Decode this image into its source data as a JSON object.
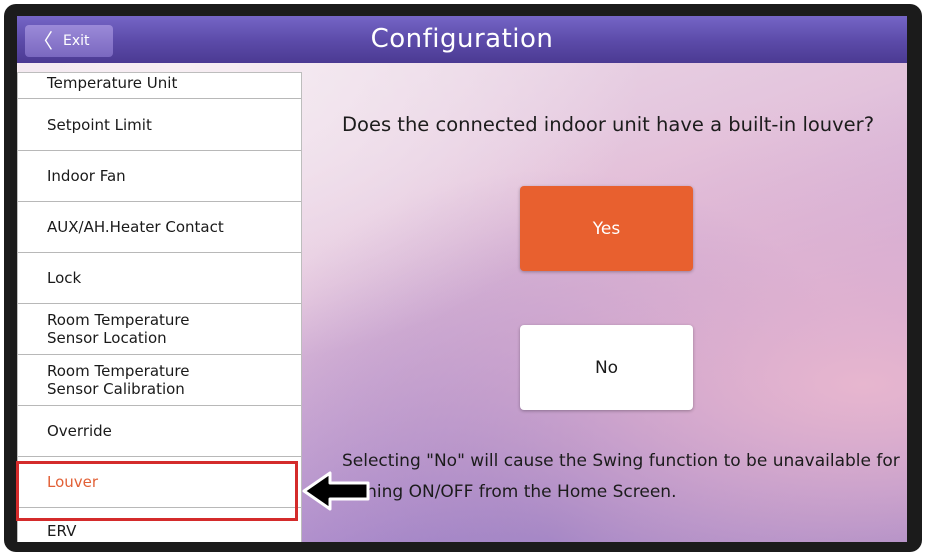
{
  "header": {
    "exit_label": "Exit",
    "title": "Configuration"
  },
  "sidebar": {
    "items": [
      {
        "line1": "Temperature Unit",
        "line2": ""
      },
      {
        "line1": "Setpoint Limit",
        "line2": ""
      },
      {
        "line1": "Indoor Fan",
        "line2": ""
      },
      {
        "line1": "AUX/AH.Heater Contact",
        "line2": ""
      },
      {
        "line1": "Lock",
        "line2": ""
      },
      {
        "line1": "Room Temperature",
        "line2": "Sensor Location"
      },
      {
        "line1": "Room Temperature",
        "line2": "Sensor Calibration"
      },
      {
        "line1": "Override",
        "line2": ""
      },
      {
        "line1": "Louver",
        "line2": ""
      },
      {
        "line1": "ERV",
        "line2": ""
      }
    ],
    "active": "Louver"
  },
  "main": {
    "question": "Does the connected indoor unit have a built-in louver?",
    "yes_label": "Yes",
    "no_label": "No",
    "note": "Selecting \"No\" will cause the Swing function to be unavailable for turning ON/OFF from the Home Screen."
  },
  "colors": {
    "accent": "#e8602f",
    "header": "#5b4aa8",
    "highlight": "#d42b2b",
    "active_text": "#e26036"
  },
  "icons": {
    "exit": "chevron-left-icon",
    "pointer": "arrow-left-icon"
  }
}
